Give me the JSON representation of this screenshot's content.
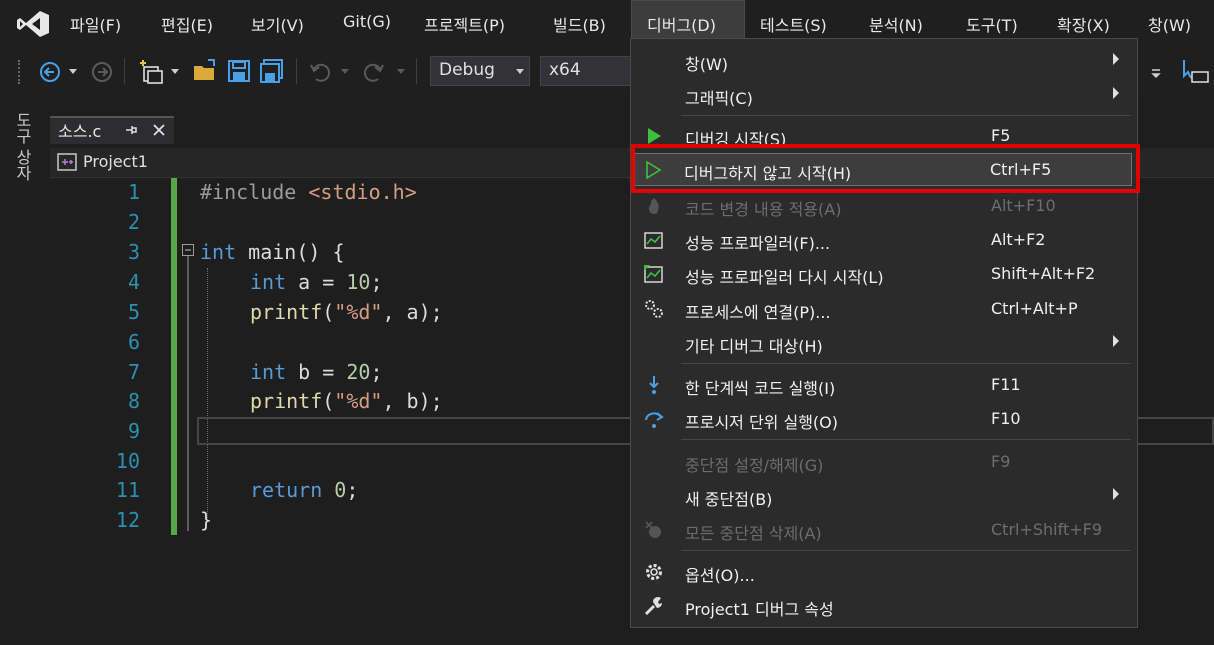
{
  "menubar": {
    "items": [
      "파일(F)",
      "편집(E)",
      "보기(V)",
      "Git(G)",
      "프로젝트(P)",
      "빌드(B)",
      "디버그(D)",
      "테스트(S)",
      "분석(N)",
      "도구(T)",
      "확장(X)",
      "창(W)"
    ]
  },
  "toolbar": {
    "configuration": "Debug",
    "platform": "x64"
  },
  "left_strip": {
    "toolbox_label": "도구 상자"
  },
  "document": {
    "tab_title": "소스.c",
    "project": "Project1"
  },
  "editor": {
    "line_numbers": [
      "1",
      "2",
      "3",
      "4",
      "5",
      "6",
      "7",
      "8",
      "9",
      "10",
      "11",
      "12"
    ],
    "code": {
      "l1_directive": "#include",
      "l1_header": "<stdio.h>",
      "l3_type": "int",
      "l3_rest": " main() {",
      "l4_type": "int",
      "l4_mid": " a = ",
      "l4_num": "10",
      "l4_end": ";",
      "l5_fn": "printf",
      "l5_open": "(",
      "l5_str": "\"%d\"",
      "l5_rest": ", a);",
      "l7_type": "int",
      "l7_mid": " b = ",
      "l7_num": "20",
      "l7_end": ";",
      "l8_fn": "printf",
      "l8_open": "(",
      "l8_str": "\"%d\"",
      "l8_rest": ", b);",
      "l11_kw": "return",
      "l11_num": " 0",
      "l11_end": ";",
      "l12": "}"
    }
  },
  "debug_menu": {
    "items": [
      {
        "label": "창(W)",
        "shortcut": "",
        "submenu": true,
        "enabled": true,
        "icon": ""
      },
      {
        "label": "그래픽(C)",
        "shortcut": "",
        "submenu": true,
        "enabled": true,
        "icon": ""
      },
      {
        "label": "디버깅 시작(S)",
        "shortcut": "F5",
        "submenu": false,
        "enabled": true,
        "icon": "play-filled-icon"
      },
      {
        "label": "디버그하지 않고 시작(H)",
        "shortcut": "Ctrl+F5",
        "submenu": false,
        "enabled": true,
        "icon": "play-outline-icon"
      },
      {
        "label": "코드 변경 내용 적용(A)",
        "shortcut": "Alt+F10",
        "submenu": false,
        "enabled": false,
        "icon": "hot-reload-icon"
      },
      {
        "label": "성능 프로파일러(F)...",
        "shortcut": "Alt+F2",
        "submenu": false,
        "enabled": true,
        "icon": "profiler-icon"
      },
      {
        "label": "성능 프로파일러 다시 시작(L)",
        "shortcut": "Shift+Alt+F2",
        "submenu": false,
        "enabled": true,
        "icon": "profiler-restart-icon"
      },
      {
        "label": "프로세스에 연결(P)...",
        "shortcut": "Ctrl+Alt+P",
        "submenu": false,
        "enabled": true,
        "icon": "attach-process-icon"
      },
      {
        "label": "기타 디버그 대상(H)",
        "shortcut": "",
        "submenu": true,
        "enabled": true,
        "icon": ""
      },
      {
        "label": "한 단계씩 코드 실행(I)",
        "shortcut": "F11",
        "submenu": false,
        "enabled": true,
        "icon": "step-into-icon"
      },
      {
        "label": "프로시저 단위 실행(O)",
        "shortcut": "F10",
        "submenu": false,
        "enabled": true,
        "icon": "step-over-icon"
      },
      {
        "label": "중단점 설정/해제(G)",
        "shortcut": "F9",
        "submenu": false,
        "enabled": false,
        "icon": ""
      },
      {
        "label": "새 중단점(B)",
        "shortcut": "",
        "submenu": true,
        "enabled": true,
        "icon": ""
      },
      {
        "label": "모든 중단점 삭제(A)",
        "shortcut": "Ctrl+Shift+F9",
        "submenu": false,
        "enabled": false,
        "icon": "delete-breakpoints-icon"
      },
      {
        "label": "옵션(O)...",
        "shortcut": "",
        "submenu": false,
        "enabled": true,
        "icon": "gear-icon"
      },
      {
        "label": "Project1 디버그 속성",
        "shortcut": "",
        "submenu": false,
        "enabled": true,
        "icon": "wrench-icon"
      }
    ]
  },
  "colors": {
    "highlight_border": "#e00000",
    "margin_green": "#57a64a",
    "play_green": "#3fbf3f"
  }
}
